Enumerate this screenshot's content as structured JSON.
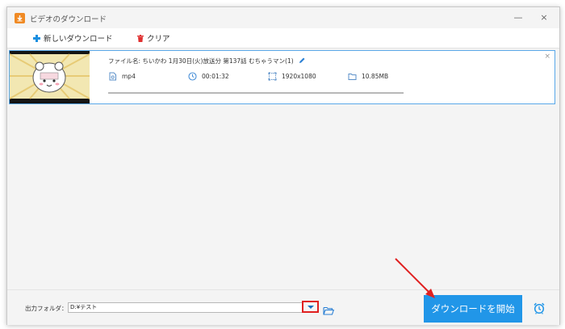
{
  "window": {
    "title": "ビデオのダウンロード",
    "minimize_glyph": "—",
    "close_glyph": "×"
  },
  "toolbar": {
    "new_download_label": "新しいダウンロード",
    "clear_label": "クリア"
  },
  "item": {
    "filename": "ファイル名: ちいかわ 1月30日(火)放送分 第137話 むちゃうマン(1)",
    "format": "mp4",
    "duration": "00:01:32",
    "resolution": "1920x1080",
    "size": "10.85MB",
    "close_glyph": "×",
    "progress": 0
  },
  "bottom": {
    "output_folder_label": "出力フォルダ：",
    "output_folder_value": "D:¥テスト",
    "start_button_label": "ダウンロードを開始"
  },
  "colors": {
    "accent": "#2196e8",
    "highlight_box": "#e02020",
    "annotation_arrow": "#e02020",
    "app_icon": "#f08a24"
  },
  "icons": [
    "app-download-icon",
    "plus-icon",
    "trash-icon",
    "pencil-icon",
    "file-format-icon",
    "clock-icon",
    "resolution-icon",
    "folder-size-icon",
    "dropdown-arrow-icon",
    "folder-open-icon",
    "alarm-clock-icon"
  ]
}
